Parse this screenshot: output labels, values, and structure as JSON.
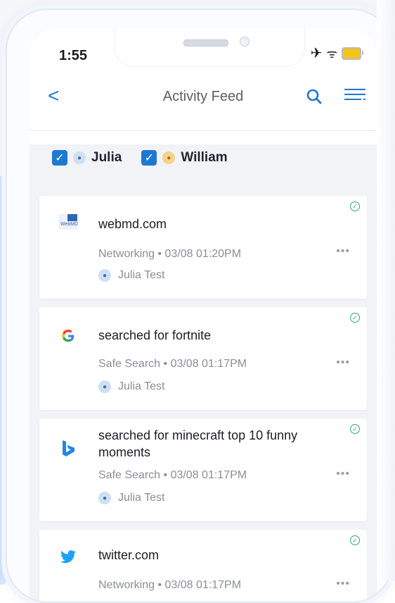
{
  "status": {
    "time": "1:55"
  },
  "nav": {
    "back": "<",
    "title": "Activity Feed"
  },
  "filters": [
    {
      "name": "Julia",
      "checked": true
    },
    {
      "name": "William",
      "checked": true
    }
  ],
  "feed": [
    {
      "title": "webmd.com",
      "category": "Networking",
      "timestamp": "03/08 01:20PM",
      "user": "Julia Test",
      "icon": "webmd-icon"
    },
    {
      "title": "searched for fortnite",
      "category": "Safe Search",
      "timestamp": "03/08 01:17PM",
      "user": "Julia Test",
      "icon": "google-icon"
    },
    {
      "title": "searched for minecraft top 10 funny moments",
      "category": "Safe Search",
      "timestamp": "03/08 01:17PM",
      "user": "Julia Test",
      "icon": "bing-icon"
    },
    {
      "title": "twitter.com",
      "category": "Networking",
      "timestamp": "03/08 01:17PM",
      "user": "",
      "icon": "twitter-icon"
    }
  ],
  "colors": {
    "accent": "#1f77d1",
    "ok": "#3aa56a"
  }
}
